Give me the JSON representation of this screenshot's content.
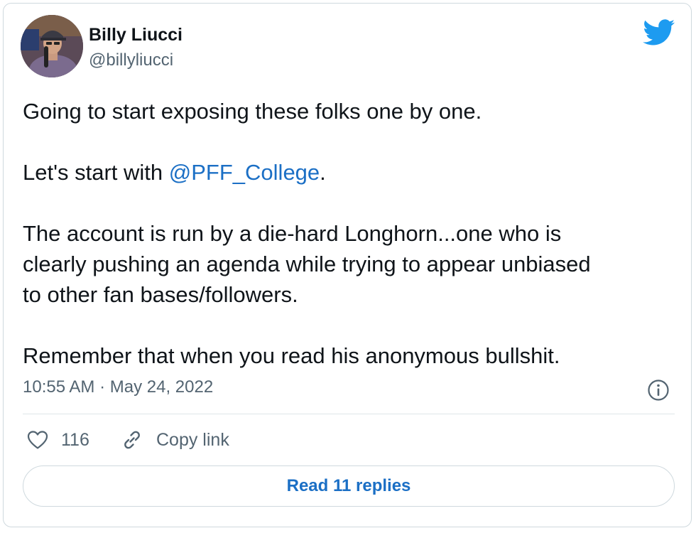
{
  "author": {
    "name": "Billy Liucci",
    "handle": "@billyliucci"
  },
  "tweet": {
    "line1": "Going to start exposing these folks one by one.",
    "line2_prefix": "Let's start with ",
    "line2_mention": "@PFF_College",
    "line2_suffix": ".",
    "line3a": "The account is run by a die-hard Longhorn...one who is",
    "line3b": "clearly pushing an agenda while trying to appear unbiased",
    "line3c": "to other fan bases/followers.",
    "line4": "Remember that when you read his anonymous bullshit."
  },
  "meta": {
    "time": "10:55 AM",
    "separator": " · ",
    "date": "May 24, 2022"
  },
  "actions": {
    "like_count": "116",
    "copy_link_label": "Copy link"
  },
  "replies_button_label": "Read 11 replies",
  "colors": {
    "link": "#1b6fc5",
    "twitter_brand": "#1d9bf0",
    "secondary_text": "#536471"
  },
  "icons": [
    "twitter-bird-icon",
    "info-icon",
    "heart-icon",
    "link-icon"
  ]
}
